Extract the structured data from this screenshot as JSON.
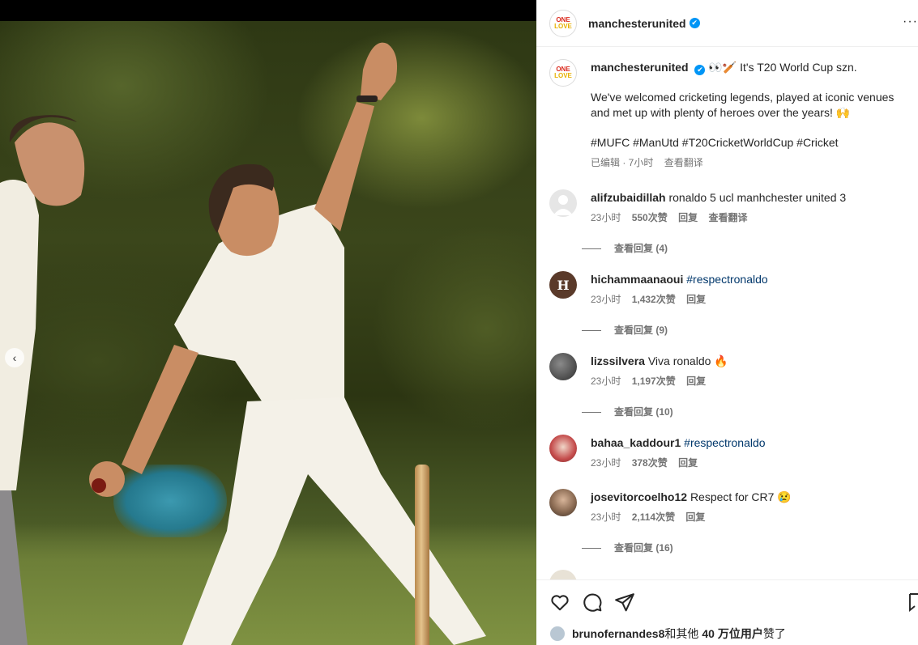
{
  "post": {
    "account": "manchesterunited",
    "avatar_text_top": "ONE",
    "avatar_text_bottom": "LOVE",
    "more_label": "···",
    "verified_mark": "✔"
  },
  "caption": {
    "account": "manchesterunited",
    "emoji_lead": "👀🏏",
    "headline": "It's T20 World Cup szn.",
    "body": "We've welcomed cricketing legends, played at iconic venues and met up with plenty of heroes over the years! 🙌",
    "hashtags": "#MUFC #ManUtd #T20CricketWorldCup #Cricket",
    "edited_time": "已编辑 · 7小时",
    "translate": "查看翻译"
  },
  "comments": [
    {
      "user": "alifzubaidillah",
      "text": "ronaldo 5 ucl manhchester united 3",
      "is_tag": false,
      "time": "23小时",
      "likes": "550次赞",
      "reply": "回复",
      "translate": "查看翻译",
      "view_replies": "查看回复 (4)",
      "avatar_color": "#e0e0e0"
    },
    {
      "user": "hichammaanaoui",
      "text": "#respectronaldo",
      "is_tag": true,
      "time": "23小时",
      "likes": "1,432次赞",
      "reply": "回复",
      "view_replies": "查看回复 (9)",
      "avatar_color": "#5a3a2a"
    },
    {
      "user": "lizssilvera",
      "text": "Viva ronaldo 🔥",
      "is_tag": false,
      "time": "23小时",
      "likes": "1,197次赞",
      "reply": "回复",
      "view_replies": "查看回复 (10)",
      "avatar_color": "#3b3b3b"
    },
    {
      "user": "bahaa_kaddour1",
      "text": "#respectronaldo",
      "is_tag": true,
      "time": "23小时",
      "likes": "378次赞",
      "reply": "回复",
      "avatar_color": "#c44b4b"
    },
    {
      "user": "josevitorcoelho12",
      "text": "Respect for CR7 😢",
      "is_tag": false,
      "time": "23小时",
      "likes": "2,114次赞",
      "reply": "回复",
      "view_replies": "查看回复 (16)",
      "avatar_color": "#6b5340"
    }
  ],
  "likes": {
    "liker": "brunofernandes8",
    "middle": "和其他",
    "count": "40 万位用户",
    "suffix": "赞了"
  },
  "icons": [
    "heart-icon",
    "comment-icon",
    "share-icon",
    "bookmark-icon",
    "chevron-left-icon"
  ],
  "colors": {
    "link": "#00376b",
    "verified": "#0095f6",
    "muted": "#737373",
    "brand_red": "#da291c"
  }
}
